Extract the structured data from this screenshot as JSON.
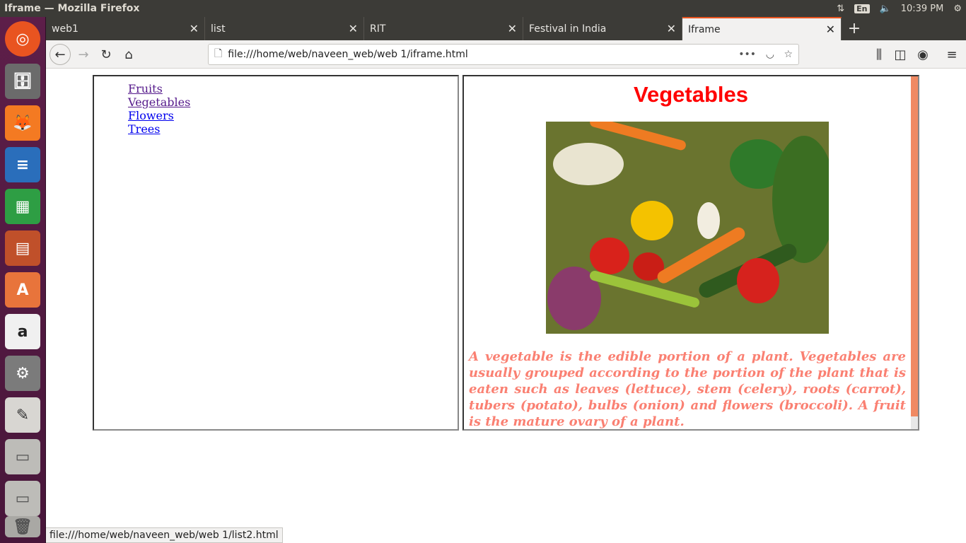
{
  "window": {
    "title": "Iframe — Mozilla Firefox",
    "lang": "En",
    "time": "10:39 PM"
  },
  "tabs": [
    {
      "label": "web1",
      "active": false
    },
    {
      "label": "list",
      "active": false
    },
    {
      "label": "RIT",
      "active": false
    },
    {
      "label": "Festival in India",
      "active": false
    },
    {
      "label": "Iframe",
      "active": true
    }
  ],
  "url": "file:///home/web/naveen_web/web 1/iframe.html",
  "left_frame": {
    "links": [
      "Fruits",
      "Vegetables",
      "Flowers",
      "Trees"
    ]
  },
  "right_frame": {
    "heading": "Vegetables",
    "image_alt": "vegetables-photo",
    "description": "A vegetable is the edible portion of a plant. Vegetables are usually grouped according to the portion of the plant that is eaten such as leaves (lettuce), stem (celery), roots (carrot), tubers (potato), bulbs (onion) and flowers (broccoli). A fruit is the mature ovary of a plant."
  },
  "status_url": "file:///home/web/naveen_web/web 1/list2.html",
  "launcher_icons": [
    "ubuntu-icon",
    "files-icon",
    "firefox-icon",
    "writer-icon",
    "calc-icon",
    "impress-icon",
    "software-center-icon",
    "amazon-icon",
    "settings-icon",
    "text-editor-icon",
    "drive-icon",
    "drive-icon",
    "trash-icon"
  ],
  "colors": {
    "heading": "#ff0000",
    "description": "#fa8072",
    "accent": "#e95420"
  }
}
